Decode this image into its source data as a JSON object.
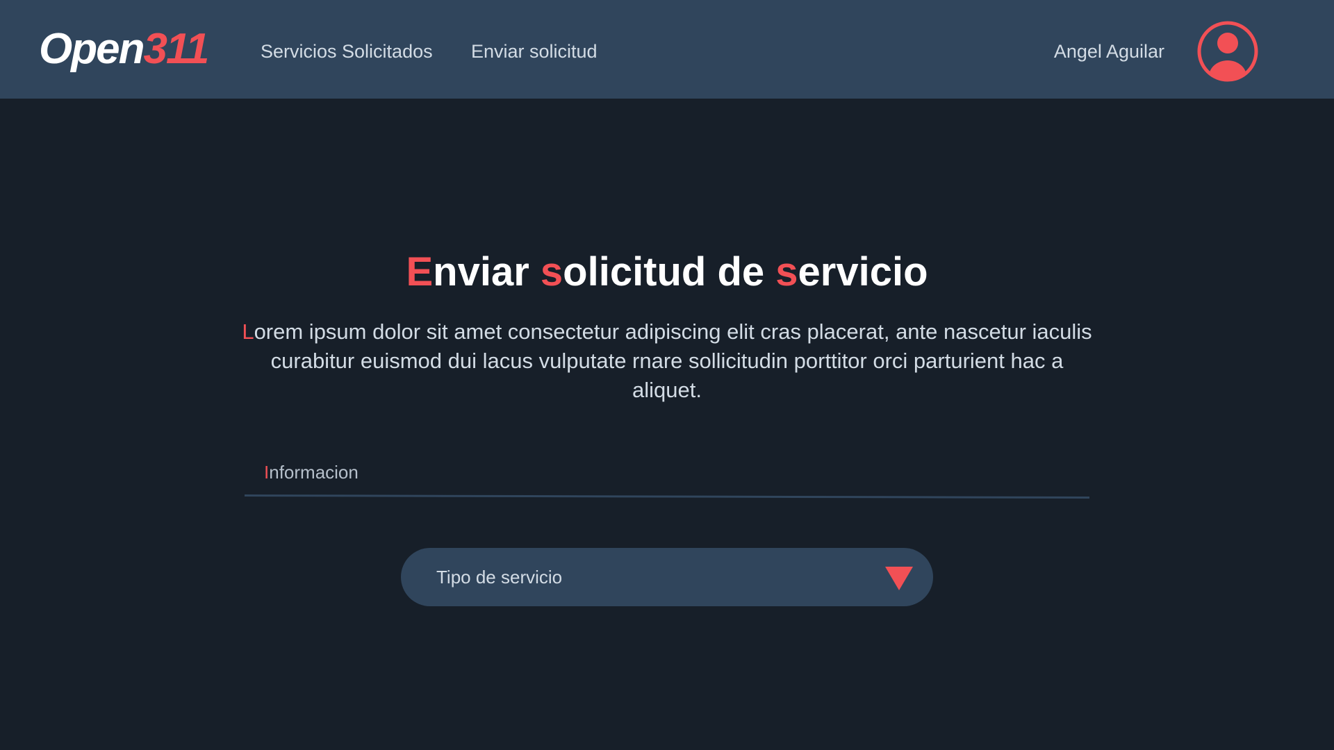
{
  "header": {
    "logo": {
      "part1": "Open",
      "part2": "311"
    },
    "nav": [
      {
        "label": "Servicios Solicitados"
      },
      {
        "label": "Enviar solicitud"
      }
    ],
    "user_name": "Angel Aguilar",
    "avatar_icon": "user-circle-icon"
  },
  "main": {
    "title": {
      "s1": "E",
      "s2": "nviar ",
      "s3": "s",
      "s4": "olicitud de ",
      "s5": "s",
      "s6": "ervicio"
    },
    "description": {
      "first_letter": "L",
      "rest": "orem ipsum dolor sit amet consectetur adipiscing elit cras placerat, ante nascetur iaculis curabitur euismod dui lacus vulputate rnare sollicitudin porttitor orci parturient hac a aliquet."
    },
    "info_field": {
      "first_letter": "I",
      "rest": "nformacion"
    },
    "service_select": {
      "placeholder": "Tipo de servicio",
      "icon": "triangle-down-icon"
    }
  },
  "colors": {
    "header_bg": "#30455c",
    "page_bg": "#171f29",
    "accent": "#f25055",
    "text": "#d3dce5"
  }
}
